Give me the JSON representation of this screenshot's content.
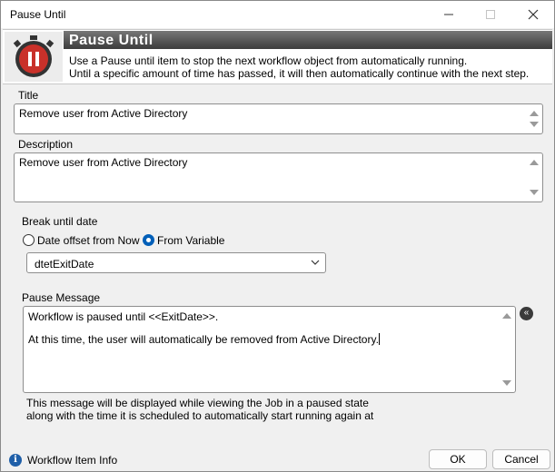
{
  "window": {
    "title": "Pause Until",
    "controls": {
      "minimize_icon": "minimize-icon",
      "maximize_icon": "maximize-icon",
      "close_icon": "close-icon"
    }
  },
  "banner": {
    "heading": "Pause Until",
    "line1": "Use a Pause until item to stop the next workflow object from automatically running.",
    "line2": "Until a specific amount of time has passed, it will then automatically continue with the next step.",
    "icon": "stopwatch-pause-icon"
  },
  "title_field": {
    "label": "Title",
    "value": "Remove user from Active Directory"
  },
  "description_field": {
    "label": "Description",
    "value": "Remove user from Active Directory"
  },
  "break_until": {
    "label": "Break until date",
    "options": [
      {
        "label": "Date offset from Now",
        "selected": false
      },
      {
        "label": "From Variable",
        "selected": true
      }
    ],
    "variable_select": {
      "value": "dtetExitDate"
    }
  },
  "pause_message": {
    "label": "Pause Message",
    "line1": "Workflow is paused until <<ExitDate>>.",
    "line2": "At this time, the user will automatically be removed from Active Directory.",
    "hint_line1": "This message will be displayed while viewing the Job in a paused state",
    "hint_line2": "along with the time it is scheduled to automatically start running again at"
  },
  "footer": {
    "info_label": "Workflow Item Info",
    "ok_label": "OK",
    "cancel_label": "Cancel"
  },
  "colors": {
    "accent": "#005fb8",
    "logo_red": "#c9312a",
    "banner_head": "#4a4a4a"
  }
}
